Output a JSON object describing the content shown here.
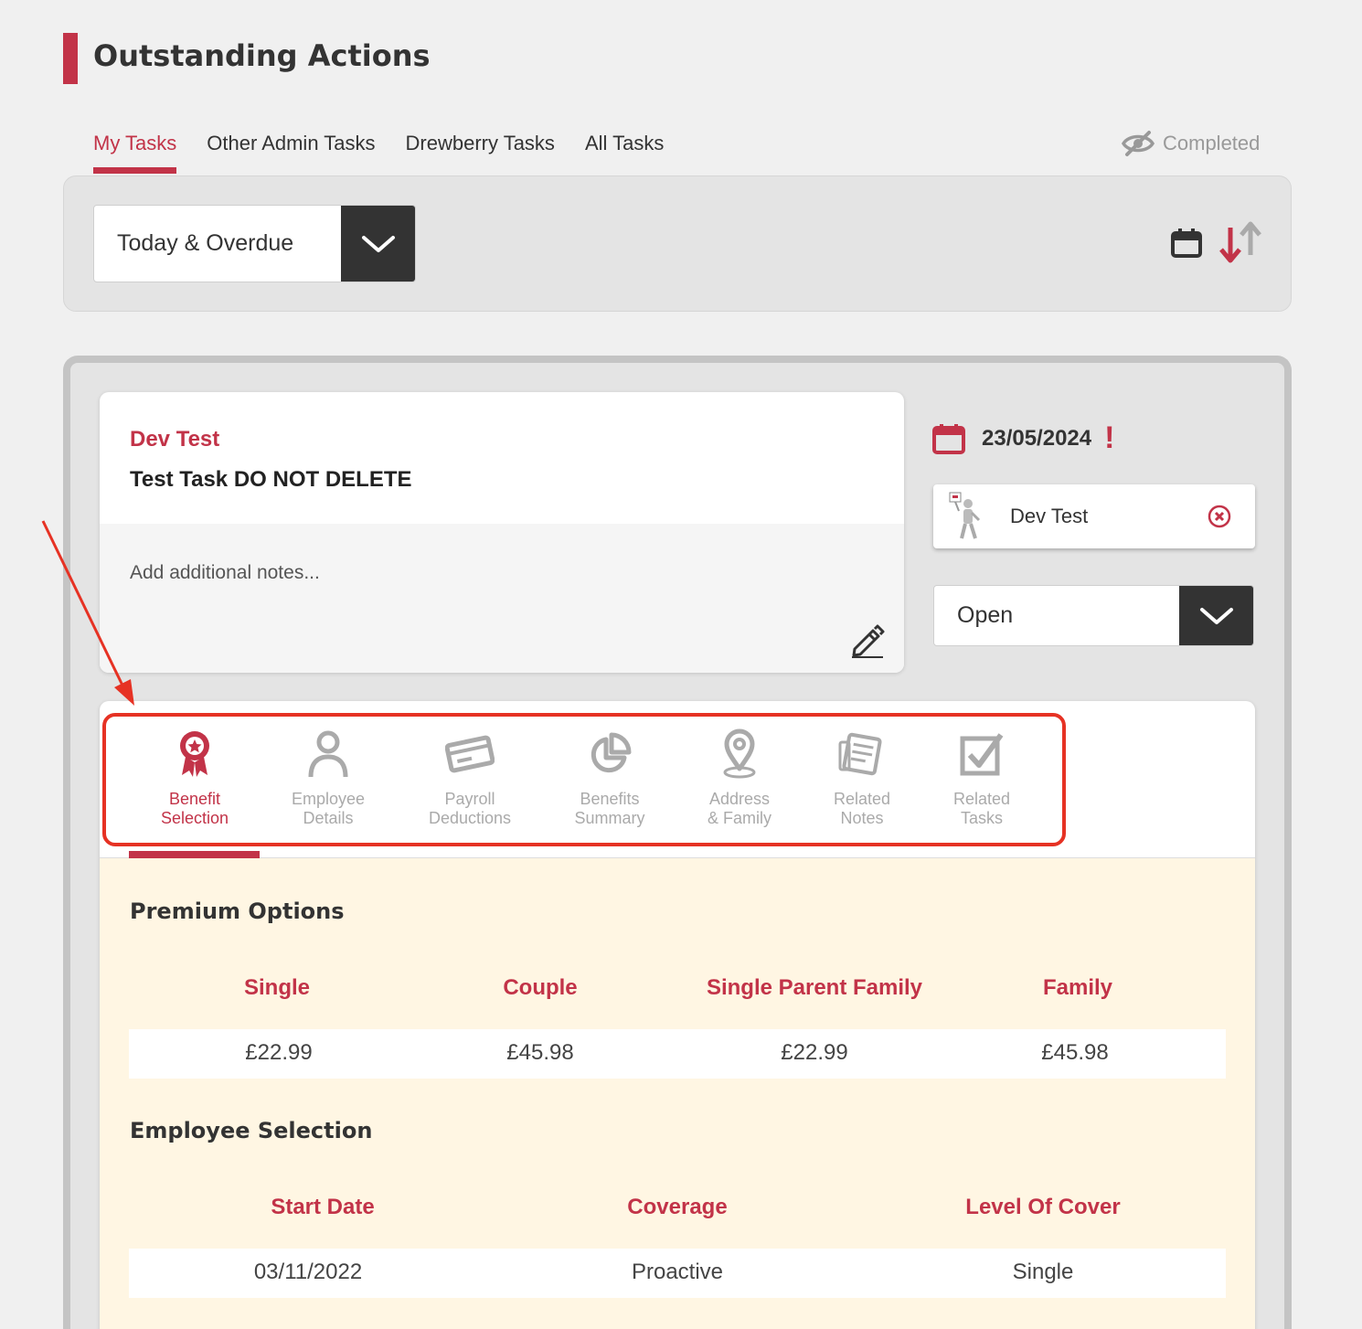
{
  "page": {
    "title": "Outstanding Actions"
  },
  "tabs": [
    {
      "label": "My Tasks"
    },
    {
      "label": "Other Admin Tasks"
    },
    {
      "label": "Drewberry Tasks"
    },
    {
      "label": "All Tasks"
    }
  ],
  "completed_toggle": {
    "label": "Completed",
    "icon": "eye-slash-icon"
  },
  "filter": {
    "selected": "Today & Overdue"
  },
  "task": {
    "owner": "Dev Test",
    "title": "Test Task DO NOT DELETE",
    "notes_placeholder": "Add additional notes...",
    "due_date": "23/05/2024",
    "due_alert": "!",
    "assignee": "Dev Test",
    "status": "Open"
  },
  "detail_tabs": [
    {
      "line1": "Benefit",
      "line2": "Selection",
      "icon": "award-icon"
    },
    {
      "line1": "Employee",
      "line2": "Details",
      "icon": "user-icon"
    },
    {
      "line1": "Payroll",
      "line2": "Deductions",
      "icon": "card-icon"
    },
    {
      "line1": "Benefits",
      "line2": "Summary",
      "icon": "pie-chart-icon"
    },
    {
      "line1": "Address",
      "line2": "& Family",
      "icon": "map-pin-icon"
    },
    {
      "line1": "Related",
      "line2": "Notes",
      "icon": "notes-icon"
    },
    {
      "line1": "Related",
      "line2": "Tasks",
      "icon": "checkbox-icon"
    }
  ],
  "premium_options": {
    "title": "Premium Options",
    "headers": [
      "Single",
      "Couple",
      "Single Parent Family",
      "Family"
    ],
    "values": [
      "£22.99",
      "£45.98",
      "£22.99",
      "£45.98"
    ]
  },
  "employee_selection": {
    "title": "Employee Selection",
    "headers": [
      "Start Date",
      "Coverage",
      "Level Of Cover"
    ],
    "values": [
      "03/11/2022",
      "Proactive",
      "Single"
    ]
  },
  "colors": {
    "accent": "#c23348",
    "highlight": "#e63224",
    "content_bg": "#fff6e3"
  }
}
